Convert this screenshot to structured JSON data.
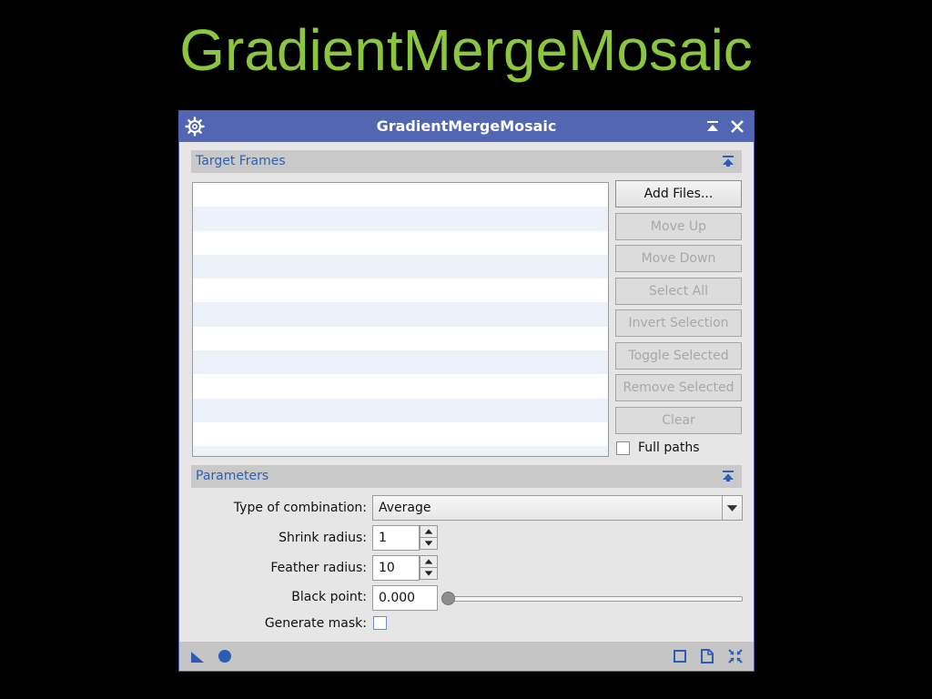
{
  "slide": {
    "title": "GradientMergeMosaic"
  },
  "window": {
    "title": "GradientMergeMosaic",
    "icons": {
      "left": "gear-icon",
      "shade": "shade-window-icon",
      "close": "close-icon"
    }
  },
  "target_frames": {
    "section_label": "Target Frames",
    "collapse_icon": "collapse-up-icon",
    "rows": 11,
    "buttons": {
      "add_files": "Add Files...",
      "move_up": "Move Up",
      "move_down": "Move Down",
      "select_all": "Select All",
      "invert_selection": "Invert Selection",
      "toggle_selected": "Toggle Selected",
      "remove_selected": "Remove Selected",
      "clear": "Clear"
    },
    "full_paths_label": "Full paths",
    "full_paths_checked": false
  },
  "parameters": {
    "section_label": "Parameters",
    "collapse_icon": "collapse-up-icon",
    "type_of_combination_label": "Type of combination:",
    "type_of_combination_value": "Average",
    "shrink_radius_label": "Shrink radius:",
    "shrink_radius_value": "1",
    "feather_radius_label": "Feather radius:",
    "feather_radius_value": "10",
    "black_point_label": "Black point:",
    "black_point_value": "0.000",
    "black_point_slider_fraction": 0.0,
    "generate_mask_label": "Generate mask:",
    "generate_mask_checked": false
  },
  "bottom_bar": {
    "icons": [
      "new-instance-triangle-icon",
      "apply-global-circle-icon",
      "preview-square-icon",
      "document-icon",
      "reset-icon"
    ]
  },
  "colors": {
    "slide_title": "#8cc63f",
    "titlebar": "#5266b4",
    "section_label": "#2d5fb0"
  }
}
